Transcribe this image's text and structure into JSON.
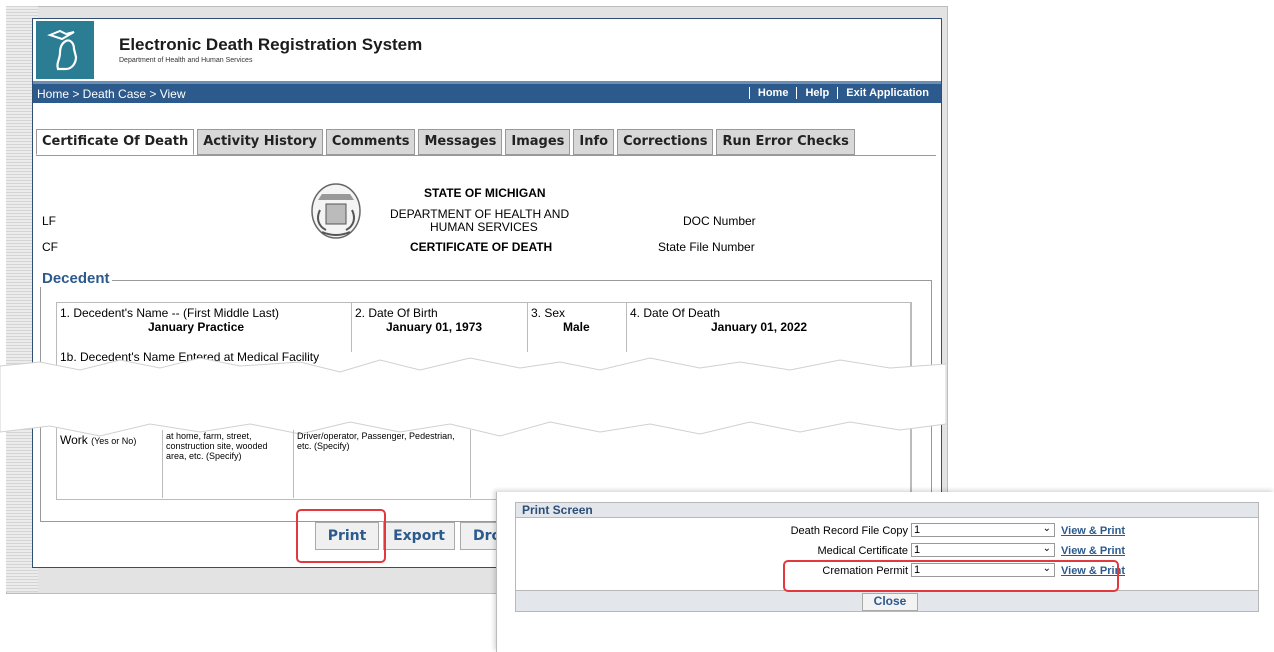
{
  "app": {
    "title": "Electronic Death Registration System",
    "subtitle": "Department of Health and Human Services"
  },
  "navbar": {
    "breadcrumb": "Home > Death Case > View",
    "links": [
      "Home",
      "Help",
      "Exit Application"
    ]
  },
  "tabs": [
    "Certificate Of Death",
    "Activity History",
    "Comments",
    "Messages",
    "Images",
    "Info",
    "Corrections",
    "Run Error Checks"
  ],
  "certificate": {
    "lf": "LF",
    "cf": "CF",
    "state": "STATE OF MICHIGAN",
    "dept": "DEPARTMENT OF HEALTH AND",
    "dept2": "HUMAN SERVICES",
    "cert_title": "CERTIFICATE OF DEATH",
    "doc_number": "DOC Number",
    "state_file_number": "State File Number"
  },
  "decedent": {
    "legend": "Decedent",
    "name_label": "1. Decedent's Name -- (First Middle Last)",
    "name_value": "January Practice",
    "dob_label": "2. Date Of Birth",
    "dob_value": "January 01, 1973",
    "sex_label": "3. Sex",
    "sex_value": "Male",
    "dod_label": "4. Date Of Death",
    "dod_value": "January 01, 2022",
    "name_medical_label": "1b. Decedent's Name Entered at Medical Facility",
    "work_label": "Work",
    "work_hint": "(Yes or No)",
    "place_hint": "at home, farm, street, construction site, wooded area, etc. (Specify)",
    "role_hint": "Driver/operator, Passenger, Pedestrian, etc. (Specify)"
  },
  "buttons": {
    "print": "Print",
    "export": "Export",
    "third": "Dro"
  },
  "print_screen": {
    "title": "Print Screen",
    "rows": [
      {
        "label": "Death Record File Copy",
        "value": "1",
        "link": "View & Print"
      },
      {
        "label": "Medical Certificate",
        "value": "1",
        "link": "View & Print"
      },
      {
        "label": "Cremation Permit",
        "value": "1",
        "link": "View & Print"
      }
    ],
    "close": "Close"
  },
  "colors": {
    "nav_bg": "#2c5a8c",
    "highlight": "#e0393e",
    "logo_bg": "#2a7d92"
  }
}
